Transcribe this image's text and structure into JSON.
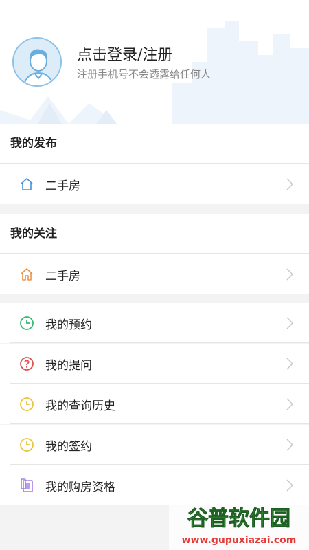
{
  "profile": {
    "title": "点击登录/注册",
    "subtitle": "注册手机号不会透露给任何人"
  },
  "sections": {
    "publish": {
      "title": "我的发布",
      "items": [
        {
          "label": "二手房",
          "icon": "house-outline-icon"
        }
      ]
    },
    "follow": {
      "title": "我的关注",
      "items": [
        {
          "label": "二手房",
          "icon": "house-orange-icon"
        }
      ]
    }
  },
  "menu": {
    "items": [
      {
        "label": "我的预约",
        "icon": "clock-green-icon",
        "color": "#3cb878"
      },
      {
        "label": "我的提问",
        "icon": "question-circle-icon",
        "color": "#e05050"
      },
      {
        "label": "我的查询历史",
        "icon": "clock-yellow-icon",
        "color": "#e8c53a"
      },
      {
        "label": "我的签约",
        "icon": "clock-yellow-icon",
        "color": "#e8c53a"
      },
      {
        "label": "我的购房资格",
        "icon": "document-icon",
        "color": "#a37de6"
      }
    ]
  },
  "watermark": {
    "name": "谷普软件园",
    "url": "www.gupuxiazai.com"
  },
  "colors": {
    "house_blue": "#4a90d9",
    "house_orange": "#e8934a",
    "chevron": "#c8c8c8"
  }
}
